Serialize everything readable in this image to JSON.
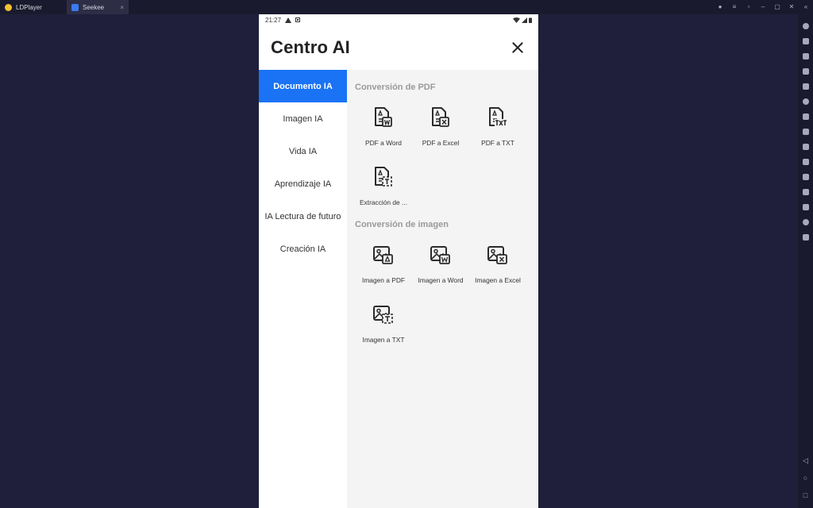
{
  "emulator": {
    "app_tab": "LDPlayer",
    "active_tab": "Seekee",
    "tab_close": "×"
  },
  "status": {
    "time": "21:27"
  },
  "header": {
    "title": "Centro AI"
  },
  "sidebar": {
    "items": [
      {
        "label": "Documento IA",
        "active": true
      },
      {
        "label": "Imagen IA"
      },
      {
        "label": "Vida IA"
      },
      {
        "label": "Aprendizaje IA"
      },
      {
        "label": "IA Lectura de futuro"
      },
      {
        "label": "Creación IA"
      }
    ]
  },
  "sections": [
    {
      "title": "Conversión de PDF",
      "items": [
        {
          "label": "PDF a Word",
          "icon": "pdf-to-word-icon"
        },
        {
          "label": "PDF a Excel",
          "icon": "pdf-to-excel-icon"
        },
        {
          "label": "PDF a TXT",
          "icon": "pdf-to-txt-icon"
        },
        {
          "label": "Extracción de ...",
          "icon": "pdf-text-extract-icon"
        }
      ]
    },
    {
      "title": "Conversión de imagen",
      "items": [
        {
          "label": "Imagen a PDF",
          "icon": "image-to-pdf-icon"
        },
        {
          "label": "Imagen a Word",
          "icon": "image-to-word-icon"
        },
        {
          "label": "Imagen a Excel",
          "icon": "image-to-excel-icon"
        },
        {
          "label": "Imagen a TXT",
          "icon": "image-to-txt-icon"
        }
      ]
    }
  ],
  "colors": {
    "accent": "#1a73f5",
    "emulator_bg": "#1f1f3b",
    "content_bg": "#f4f4f4"
  }
}
